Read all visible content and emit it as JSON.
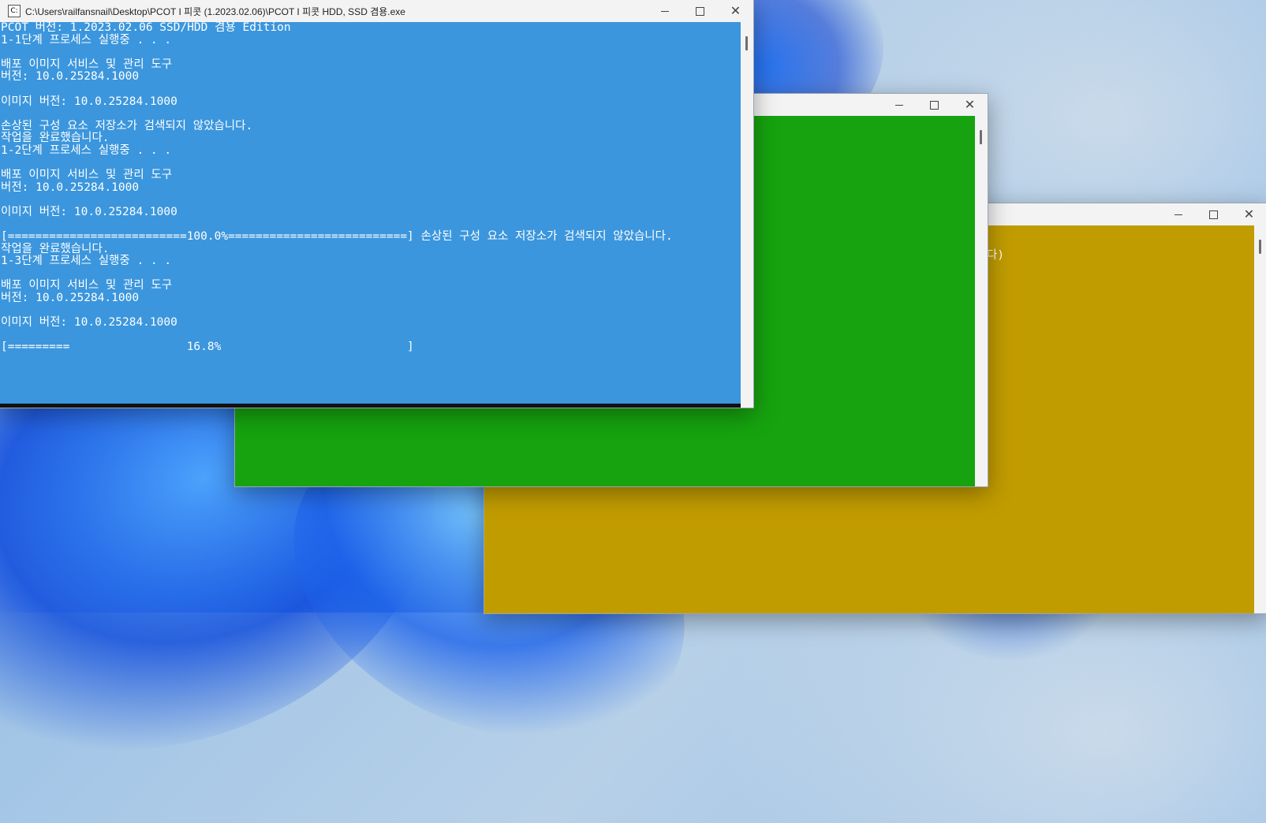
{
  "colors": {
    "console_blue": "#3b96dd",
    "console_green": "#16a30f",
    "console_yellow": "#c19c00"
  },
  "window_main": {
    "title": "C:\\Users\\railfansnail\\Desktop\\PCOT I 피콧 (1.2023.02.06)\\PCOT I 피콧 HDD, SSD 겸용.exe",
    "icon": "console-app-icon",
    "lines": [
      "PCOT 버전: 1.2023.02.06 SSD/HDD 겸용 Edition",
      "1-1단계 프로세스 실행중 . . .",
      "",
      "배포 이미지 서비스 및 관리 도구",
      "버전: 10.0.25284.1000",
      "",
      "이미지 버전: 10.0.25284.1000",
      "",
      "손상된 구성 요소 저장소가 검색되지 않았습니다.",
      "작업을 완료했습니다.",
      "1-2단계 프로세스 실행중 . . .",
      "",
      "배포 이미지 서비스 및 관리 도구",
      "버전: 10.0.25284.1000",
      "",
      "이미지 버전: 10.0.25284.1000",
      "",
      "[==========================100.0%==========================] 손상된 구성 요소 저장소가 검색되지 않았습니다.",
      "작업을 완료했습니다.",
      "1-3단계 프로세스 실행중 . . .",
      "",
      "배포 이미지 서비스 및 관리 도구",
      "버전: 10.0.25284.1000",
      "",
      "이미지 버전: 10.0.25284.1000",
      "",
      "[=========                 16.8%                           ]"
    ],
    "progress_percent": 16.8
  },
  "window_green": {
    "title": ""
  },
  "window_yellow": {
    "title": "",
    "visible_fragment": "다)"
  },
  "caption": {
    "minimize": "minimize-icon",
    "maximize": "maximize-icon",
    "close": "close-icon"
  }
}
